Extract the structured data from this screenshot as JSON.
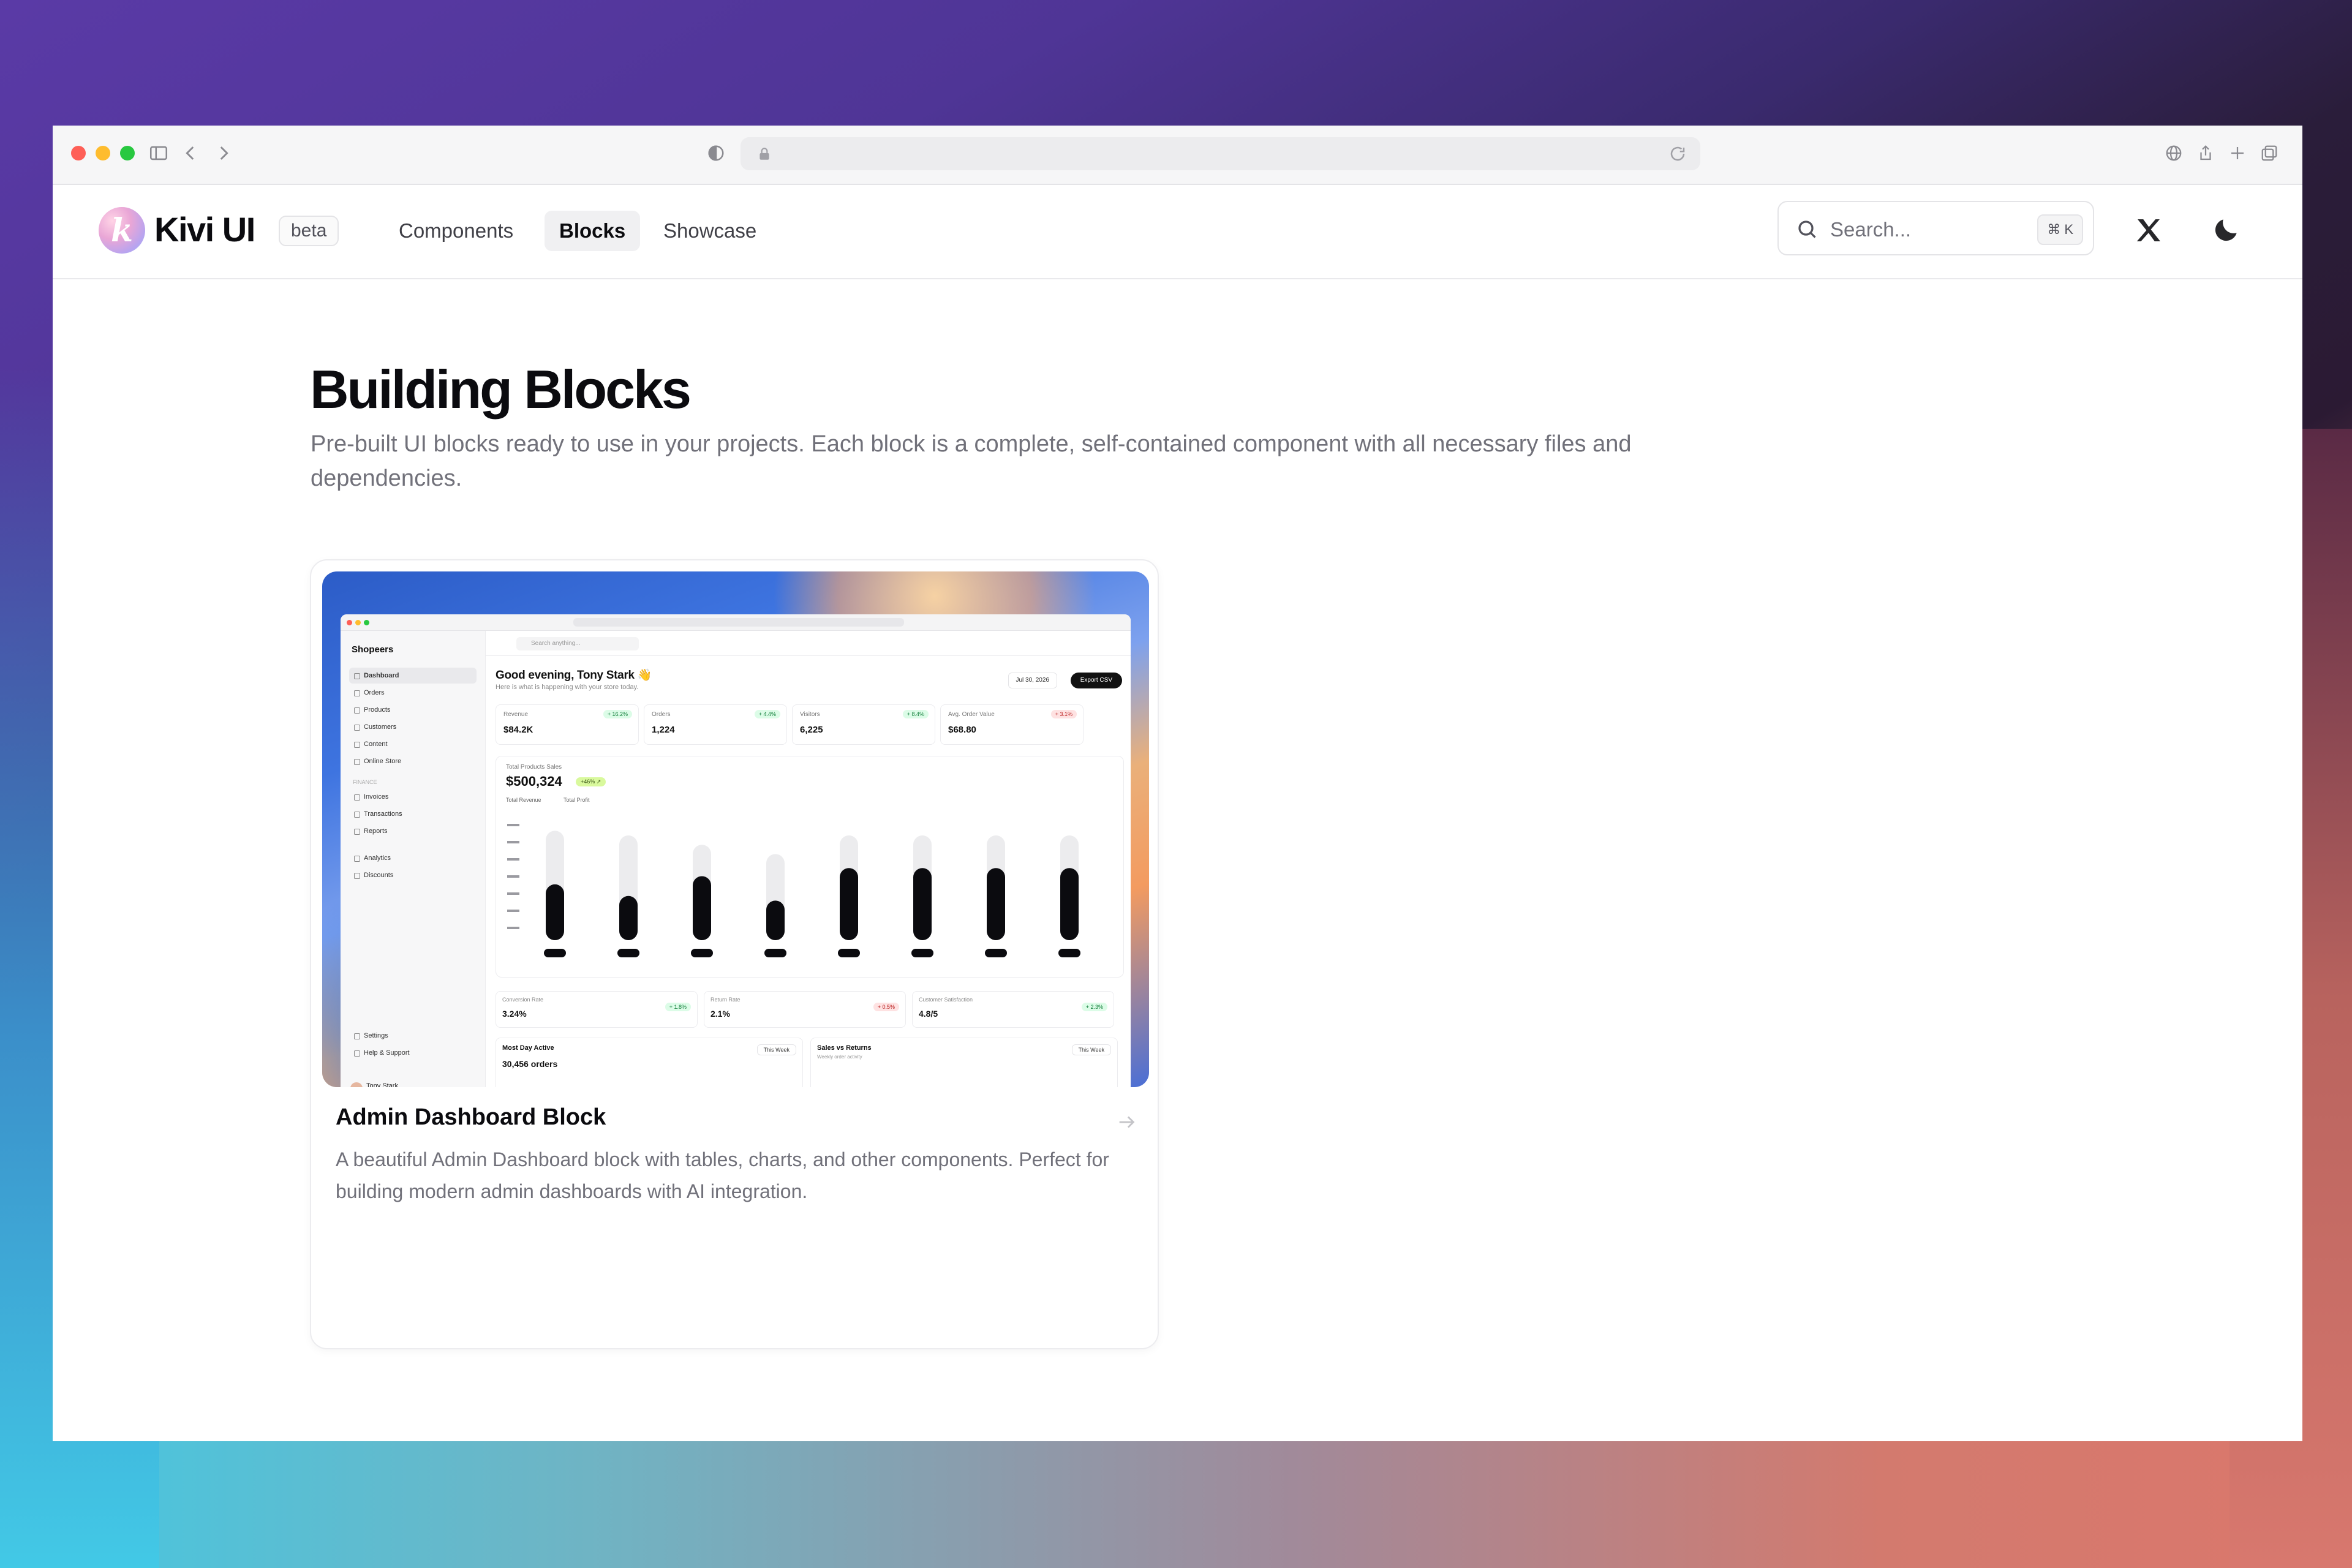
{
  "brand": {
    "name": "Kivi UI",
    "mark": "k",
    "badge": "beta"
  },
  "nav": {
    "items": [
      {
        "label": "Components",
        "active": false
      },
      {
        "label": "Blocks",
        "active": true
      },
      {
        "label": "Showcase",
        "active": false
      }
    ]
  },
  "search": {
    "placeholder": "Search...",
    "shortcut": "⌘ K"
  },
  "header_icons": [
    "x-icon",
    "moon-icon"
  ],
  "page": {
    "title": "Building Blocks",
    "description": "Pre-built UI blocks ready to use in your projects. Each block is a complete, self-contained component with all necessary files and dependencies."
  },
  "card": {
    "title": "Admin Dashboard Block",
    "description": "A beautiful Admin Dashboard block with tables, charts, and other components. Perfect for building modern admin dashboards with AI integration.",
    "preview": {
      "brand": "Shopeers",
      "search_placeholder": "Search anything...",
      "nav": [
        "Dashboard",
        "Orders",
        "Products",
        "Customers",
        "Content",
        "Online Store"
      ],
      "finance_label": "FINANCE",
      "finance_nav": [
        "Invoices",
        "Transactions",
        "Reports"
      ],
      "more_nav": [
        "Analytics",
        "Discounts"
      ],
      "footer_nav": [
        "Settings",
        "Help & Support"
      ],
      "user_name": "Tony Stark",
      "greeting": "Good evening, Tony Stark 👋",
      "subtitle": "Here is what is happening with your store today.",
      "date": "Jul 30, 2026",
      "export_label": "Export CSV",
      "stats": [
        {
          "label": "Revenue",
          "value": "$84.2K",
          "change": "+ 16.2%",
          "dir": "up"
        },
        {
          "label": "Orders",
          "value": "1,224",
          "change": "+ 4.4%",
          "dir": "up"
        },
        {
          "label": "Visitors",
          "value": "6,225",
          "change": "+ 8.4%",
          "dir": "up"
        },
        {
          "label": "Avg. Order Value",
          "value": "$68.80",
          "change": "+ 3.1%",
          "dir": "down"
        }
      ],
      "chart_title": "Total Products Sales",
      "chart_value": "$500,324",
      "chart_badge": "+46% ↗",
      "chart_legend": [
        "Total Revenue",
        "Total Profit"
      ],
      "chart_bars": [
        0.48,
        0.38,
        0.55,
        0.34,
        0.62,
        0.62,
        0.62,
        0.62
      ],
      "chart_shadow": [
        0.94,
        0.9,
        0.82,
        0.74,
        0.9,
        0.9,
        0.9,
        0.9
      ],
      "kpis": [
        {
          "label": "Conversion Rate",
          "value": "3.24%",
          "change": "+ 1.8%",
          "dir": "up"
        },
        {
          "label": "Return Rate",
          "value": "2.1%",
          "change": "+ 0.5%",
          "dir": "down"
        },
        {
          "label": "Customer Satisfaction",
          "value": "4.8/5",
          "change": "+ 2.3%",
          "dir": "up"
        }
      ],
      "bottom": [
        {
          "title": "Most Day Active",
          "value": "30,456 orders",
          "select": "This Week"
        },
        {
          "title": "Sales vs Returns",
          "subtitle": "Weekly order activity",
          "select": "This Week"
        }
      ]
    }
  }
}
